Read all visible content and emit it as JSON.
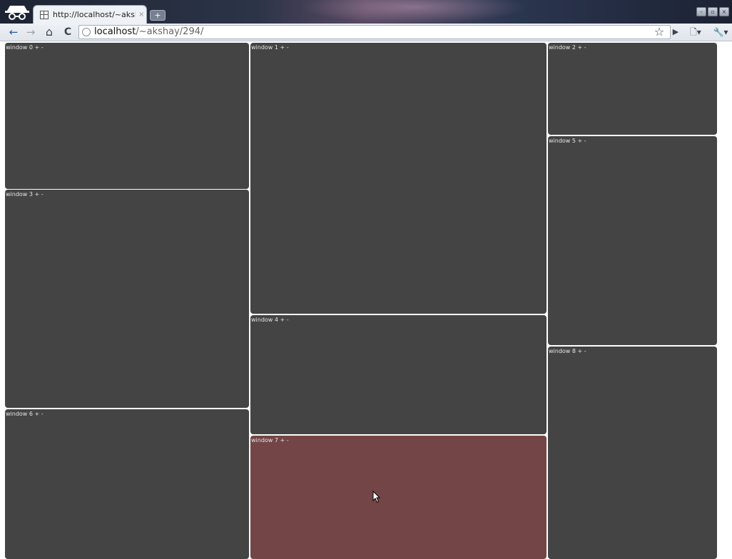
{
  "browser": {
    "tab_title": "http://localhost/~aksha...",
    "tab_close": "×",
    "new_tab": "+",
    "url_host": "localhost",
    "url_path": "/~akshay/294/",
    "window_controls": {
      "minimize": "–",
      "maximize": "▫",
      "close": "×"
    }
  },
  "toolbar": {
    "back": "←",
    "forward": "→",
    "home": "⌂",
    "reload": "C",
    "bookmark": "☆",
    "play": "▶",
    "page_menu": "🗋▾",
    "wrench_menu": "🔧▾"
  },
  "icons": {
    "incognito": "incognito-icon",
    "favicon": "page-favicon-icon",
    "globe": "globe-icon",
    "cursor": "mouse-cursor-icon"
  },
  "windows": [
    {
      "label": "window 0",
      "plus": "+",
      "minus": "-",
      "active": false
    },
    {
      "label": "window 1",
      "plus": "+",
      "minus": "-",
      "active": false
    },
    {
      "label": "window 2",
      "plus": "+",
      "minus": "-",
      "active": false
    },
    {
      "label": "window 3",
      "plus": "+",
      "minus": "-",
      "active": false
    },
    {
      "label": "window 4",
      "plus": "+",
      "minus": "-",
      "active": false
    },
    {
      "label": "window 5",
      "plus": "+",
      "minus": "-",
      "active": false
    },
    {
      "label": "window 6",
      "plus": "+",
      "minus": "-",
      "active": false
    },
    {
      "label": "window 7",
      "plus": "+",
      "minus": "-",
      "active": true
    },
    {
      "label": "window 8",
      "plus": "+",
      "minus": "-",
      "active": false
    }
  ],
  "colors": {
    "window_bg": "#444444",
    "window_active_bg": "#744546",
    "page_bg": "#ffffff"
  }
}
